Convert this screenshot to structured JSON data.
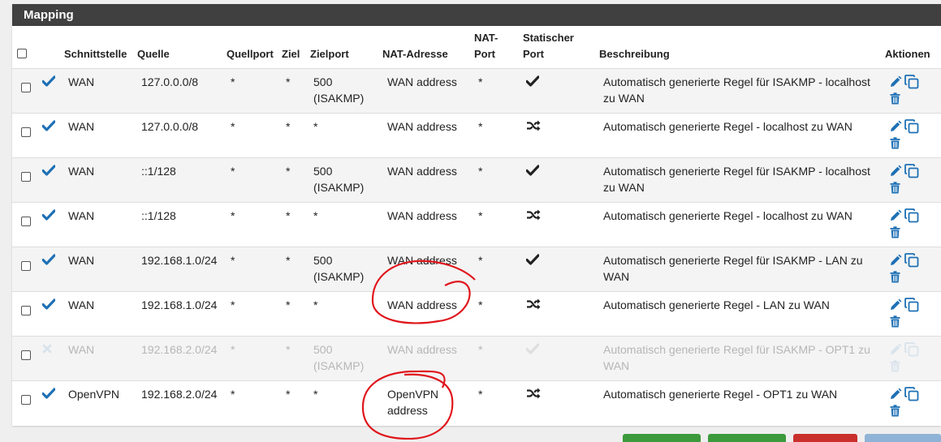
{
  "panel": {
    "title": "Mapping"
  },
  "headers": {
    "schnittstelle": "Schnittstelle",
    "quelle": "Quelle",
    "quellport": "Quellport",
    "ziel": "Ziel",
    "zielport": "Zielport",
    "nat_adresse": "NAT-Adresse",
    "nat_port_1": "NAT-",
    "nat_port_2": "Port",
    "statischer_port_1": "Statischer",
    "statischer_port_2": "Port",
    "beschreibung": "Beschreibung",
    "aktionen": "Aktionen"
  },
  "rows": [
    {
      "enabled": true,
      "interface": "WAN",
      "source": "127.0.0.0/8",
      "source_port": "*",
      "dest": "*",
      "dest_port_1": "500",
      "dest_port_2": "(ISAKMP)",
      "nat_address_1": "WAN address",
      "nat_address_2": "",
      "nat_port": "*",
      "static_port_icon": "check-icon",
      "description_1": "Automatisch generierte Regel für ISAKMP - localhost",
      "description_2": "zu WAN"
    },
    {
      "enabled": true,
      "interface": "WAN",
      "source": "127.0.0.0/8",
      "source_port": "*",
      "dest": "*",
      "dest_port_1": "*",
      "dest_port_2": "",
      "nat_address_1": "WAN address",
      "nat_address_2": "",
      "nat_port": "*",
      "static_port_icon": "random-icon",
      "description_1": "Automatisch generierte Regel - localhost zu WAN",
      "description_2": ""
    },
    {
      "enabled": true,
      "interface": "WAN",
      "source": "::1/128",
      "source_port": "*",
      "dest": "*",
      "dest_port_1": "500",
      "dest_port_2": "(ISAKMP)",
      "nat_address_1": "WAN address",
      "nat_address_2": "",
      "nat_port": "*",
      "static_port_icon": "check-icon",
      "description_1": "Automatisch generierte Regel für ISAKMP - localhost",
      "description_2": "zu WAN"
    },
    {
      "enabled": true,
      "interface": "WAN",
      "source": "::1/128",
      "source_port": "*",
      "dest": "*",
      "dest_port_1": "*",
      "dest_port_2": "",
      "nat_address_1": "WAN address",
      "nat_address_2": "",
      "nat_port": "*",
      "static_port_icon": "random-icon",
      "description_1": "Automatisch generierte Regel - localhost zu WAN",
      "description_2": ""
    },
    {
      "enabled": true,
      "interface": "WAN",
      "source": "192.168.1.0/24",
      "source_port": "*",
      "dest": "*",
      "dest_port_1": "500",
      "dest_port_2": "(ISAKMP)",
      "nat_address_1": "WAN address",
      "nat_address_2": "",
      "nat_port": "*",
      "static_port_icon": "check-icon",
      "description_1": "Automatisch generierte Regel für ISAKMP - LAN zu",
      "description_2": "WAN"
    },
    {
      "enabled": true,
      "interface": "WAN",
      "source": "192.168.1.0/24",
      "source_port": "*",
      "dest": "*",
      "dest_port_1": "*",
      "dest_port_2": "",
      "nat_address_1": "WAN address",
      "nat_address_2": "",
      "nat_port": "*",
      "static_port_icon": "random-icon",
      "description_1": "Automatisch generierte Regel - LAN zu WAN",
      "description_2": ""
    },
    {
      "enabled": false,
      "interface": "WAN",
      "source": "192.168.2.0/24",
      "source_port": "*",
      "dest": "*",
      "dest_port_1": "500",
      "dest_port_2": "(ISAKMP)",
      "nat_address_1": "WAN address",
      "nat_address_2": "",
      "nat_port": "*",
      "static_port_icon": "check-icon",
      "description_1": "Automatisch generierte Regel für ISAKMP - OPT1 zu",
      "description_2": "WAN"
    },
    {
      "enabled": true,
      "interface": "OpenVPN",
      "source": "192.168.2.0/24",
      "source_port": "*",
      "dest": "*",
      "dest_port_1": "*",
      "dest_port_2": "",
      "nat_address_1": "OpenVPN",
      "nat_address_2": "address",
      "nat_port": "*",
      "static_port_icon": "random-icon",
      "description_1": "Automatisch generierte Regel - OPT1 zu WAN",
      "description_2": ""
    }
  ],
  "colors": {
    "header_bg": "#404040",
    "accent_blue": "#1e70b5",
    "disabled_gray": "#b6b6b6",
    "annotation_red": "#e0161c",
    "button_green": "#3c9a3c",
    "button_red": "#c9302c",
    "button_blue": "#8fb3d6"
  }
}
